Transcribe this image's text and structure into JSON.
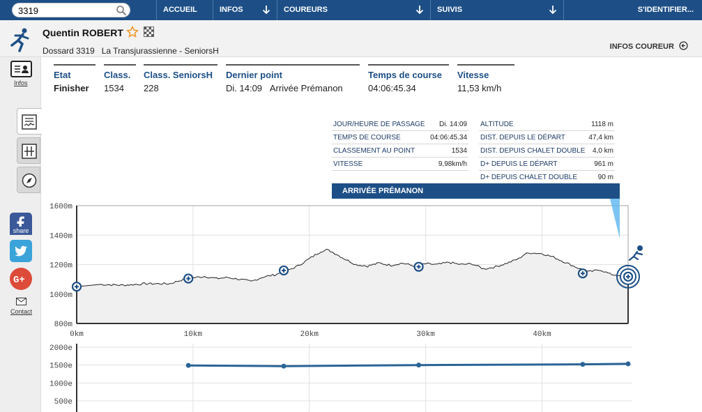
{
  "search": {
    "value": "3319"
  },
  "nav": {
    "accueil": "ACCUEIL",
    "infos": "INFOS",
    "coureurs": "COUREURS",
    "suivis": "SUIVIS",
    "identifier": "S'IDENTIFIER..."
  },
  "runner": {
    "name": "Quentin ROBERT",
    "bib": "Dossard 3319",
    "race": "La Transjurassienne - SeniorsH",
    "infos_link": "INFOS COUREUR"
  },
  "sidebar": {
    "infos_label": "Infos",
    "contact_label": "Contact",
    "share_label": "share"
  },
  "stats": {
    "etat": {
      "label": "Etat",
      "value": "Finisher"
    },
    "classement": {
      "label": "Class.",
      "value": "1534"
    },
    "class_cat": {
      "label": "Class. SeniorsH",
      "value": "228"
    },
    "dernier_point": {
      "label": "Dernier point",
      "day": "Di. 14:09",
      "place": "Arrivée Prémanon"
    },
    "temps": {
      "label": "Temps de course",
      "value": "04:06:45.34"
    },
    "vitesse": {
      "label": "Vitesse",
      "value": "11,53 km/h"
    }
  },
  "point_info": {
    "left": [
      {
        "k": "JOUR/HEURE DE PASSAGE",
        "v": "Di. 14:09"
      },
      {
        "k": "TEMPS DE COURSE",
        "v": "04:06:45.34"
      },
      {
        "k": "CLASSEMENT AU POINT",
        "v": "1534"
      },
      {
        "k": "VITESSE",
        "v": "9,98km/h"
      }
    ],
    "right": [
      {
        "k": "ALTITUDE",
        "v": "1118 m"
      },
      {
        "k": "DIST. DEPUIS LE DÉPART",
        "v": "47,4 km"
      },
      {
        "k": "DIST. DEPUIS CHALET DOUBLE",
        "v": "4,0 km"
      },
      {
        "k": "D+ DEPUIS LE DÉPART",
        "v": "961 m"
      },
      {
        "k": "D+ DEPUIS CHALET DOUBLE",
        "v": "90 m"
      }
    ],
    "banner": "ARRIVÉE PRÉMANON"
  },
  "colors": {
    "primary": "#1d4f86",
    "accent": "#2a6496",
    "highlight": "#5bb5f0"
  },
  "chart_data": [
    {
      "type": "area",
      "ylim": [
        800,
        1600
      ],
      "yticks": [
        "1600m",
        "1400m",
        "1200m",
        "1000m",
        "800m"
      ],
      "ytick_values": [
        1600,
        1400,
        1200,
        1000,
        800
      ],
      "xlim": [
        0,
        47.4
      ],
      "xticks": [
        "0km",
        "10km",
        "20km",
        "30km",
        "40km"
      ],
      "xtick_values": [
        0,
        10,
        20,
        30,
        40
      ],
      "profile": [
        [
          0,
          1050
        ],
        [
          2,
          1065
        ],
        [
          4,
          1060
        ],
        [
          6,
          1070
        ],
        [
          8,
          1070
        ],
        [
          9,
          1095
        ],
        [
          10,
          1110
        ],
        [
          11,
          1120
        ],
        [
          12,
          1105
        ],
        [
          13,
          1112
        ],
        [
          14,
          1100
        ],
        [
          15,
          1085
        ],
        [
          16,
          1115
        ],
        [
          17,
          1130
        ],
        [
          18,
          1155
        ],
        [
          19,
          1190
        ],
        [
          20,
          1240
        ],
        [
          21,
          1290
        ],
        [
          21.5,
          1300
        ],
        [
          22,
          1285
        ],
        [
          23,
          1240
        ],
        [
          24,
          1200
        ],
        [
          25,
          1190
        ],
        [
          26,
          1210
        ],
        [
          27,
          1195
        ],
        [
          28,
          1210
        ],
        [
          29,
          1190
        ],
        [
          30,
          1205
        ],
        [
          31,
          1200
        ],
        [
          32,
          1215
        ],
        [
          33,
          1200
        ],
        [
          34,
          1205
        ],
        [
          35,
          1170
        ],
        [
          36,
          1185
        ],
        [
          37,
          1210
        ],
        [
          38,
          1240
        ],
        [
          38.5,
          1270
        ],
        [
          39,
          1280
        ],
        [
          40,
          1275
        ],
        [
          41,
          1250
        ],
        [
          42,
          1215
        ],
        [
          43,
          1180
        ],
        [
          44,
          1150
        ],
        [
          45,
          1165
        ],
        [
          46,
          1130
        ],
        [
          47.4,
          1118
        ]
      ],
      "checkpoints": [
        {
          "km": 0,
          "alt": 1050
        },
        {
          "km": 9.6,
          "alt": 1105
        },
        {
          "km": 17.8,
          "alt": 1160
        },
        {
          "km": 29.4,
          "alt": 1185
        },
        {
          "km": 43.5,
          "alt": 1140
        },
        {
          "km": 47.4,
          "alt": 1118
        }
      ]
    },
    {
      "type": "line",
      "ylim": [
        500,
        2000
      ],
      "yticks": [
        "2000e",
        "1500e",
        "1000e",
        "500e"
      ],
      "ytick_values": [
        2000,
        1500,
        1000,
        500
      ],
      "series": [
        {
          "x": [
            9.6,
            17.8,
            29.4,
            43.5,
            47.4
          ],
          "y": [
            1490,
            1470,
            1500,
            1520,
            1534
          ]
        }
      ]
    }
  ]
}
